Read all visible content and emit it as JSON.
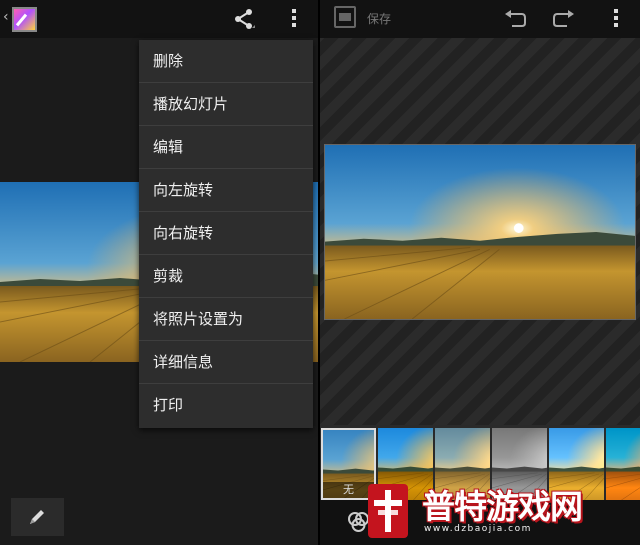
{
  "menu": {
    "items": [
      "删除",
      "播放幻灯片",
      "编辑",
      "向左旋转",
      "向右旋转",
      "剪裁",
      "将照片设置为",
      "详细信息",
      "打印"
    ]
  },
  "editor": {
    "save_label": "保存",
    "filters": [
      {
        "label": "无",
        "selected": true
      },
      {
        "label": "",
        "selected": false
      },
      {
        "label": "",
        "selected": false
      },
      {
        "label": "",
        "selected": false
      },
      {
        "label": "",
        "selected": false
      },
      {
        "label": "",
        "selected": false
      }
    ]
  },
  "watermark": {
    "title": "普特游戏网",
    "url": "www.dzbaojia.com"
  },
  "colors": {
    "menu_bg": "#2d2d2d",
    "actionbar_bg": "#121212",
    "sky_top": "#2f7fc0",
    "sun_glow": "#f5b14a",
    "field": "#b88a2e",
    "brand_red": "#b8141c"
  },
  "icons": {
    "back": "chevron-left-icon",
    "app": "gallery-icon",
    "share": "share-icon",
    "overflow": "overflow-menu-icon",
    "edit": "pencil-icon",
    "save": "photo-save-icon",
    "undo": "undo-icon",
    "redo": "redo-icon",
    "filters": "filter-icon"
  }
}
